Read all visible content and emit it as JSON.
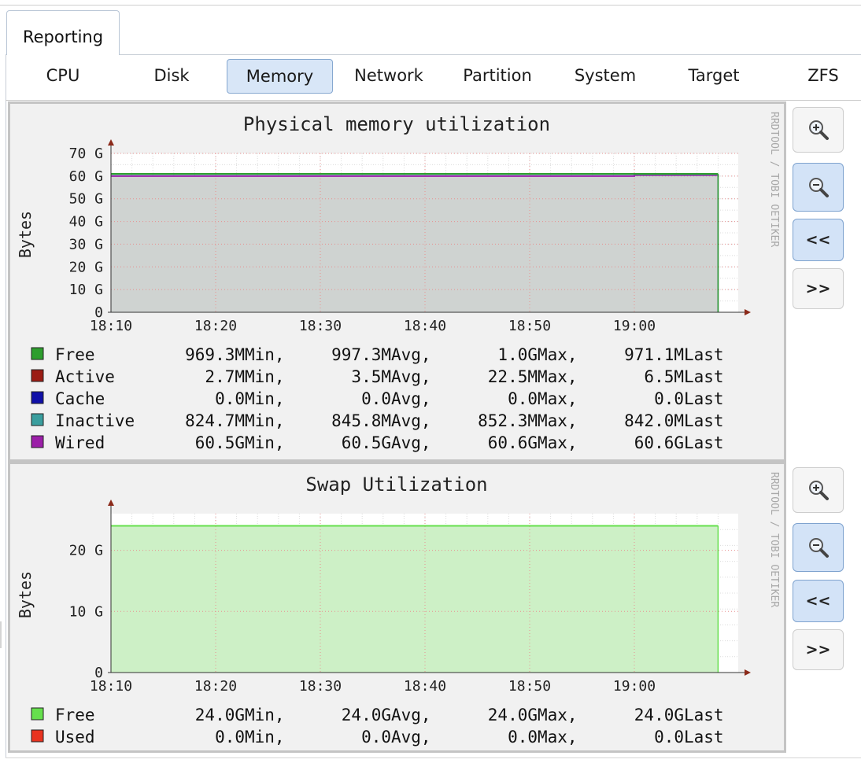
{
  "app_tab": {
    "label": "Reporting"
  },
  "subtabs": [
    {
      "label": "CPU"
    },
    {
      "label": "Disk"
    },
    {
      "label": "Memory"
    },
    {
      "label": "Network"
    },
    {
      "label": "Partition"
    },
    {
      "label": "System"
    },
    {
      "label": "Target"
    },
    {
      "label": "ZFS"
    }
  ],
  "active_subtab": "Memory",
  "graph_controls": {
    "zoom_in_icon": "magnifier-plus-icon",
    "zoom_out_icon": "magnifier-minus-icon",
    "back_label": "<<",
    "forward_label": ">>"
  },
  "watermark": "RRDTOOL / TOBI OETIKER",
  "colors": {
    "free_green": "#2e9e2e",
    "active_red": "#9b1c14",
    "cache_blue": "#1010a8",
    "inactive_teal": "#3a9e9e",
    "wired_purple": "#9b1fa8",
    "swap_free": "#66e04d",
    "swap_used": "#e8331f",
    "active_tab_bg": "#d8e6f7"
  },
  "graphs": {
    "memory": {
      "title": "Physical memory utilization",
      "ylabel": "Bytes",
      "chart_data": {
        "type": "area",
        "title": "Physical memory utilization",
        "xlabel": "",
        "ylabel": "Bytes",
        "x_ticks": [
          "18:10",
          "18:20",
          "18:30",
          "18:40",
          "18:50",
          "19:00"
        ],
        "y_ticks": [
          "0",
          "10 G",
          "20 G",
          "30 G",
          "40 G",
          "50 G",
          "60 G",
          "70 G"
        ],
        "ylim": [
          0,
          70
        ],
        "stacked": true,
        "grid": true,
        "series": [
          {
            "name": "Wired",
            "color": "#9b1fa8",
            "points": [
              [
                "18:10",
                60.0
              ],
              [
                "19:00",
                60.0
              ],
              [
                "19:00",
                60.4
              ],
              [
                "19:08",
                60.4
              ]
            ]
          },
          {
            "name": "Inactive",
            "color": "#3a9e9e",
            "points": [
              [
                "18:10",
                0.8
              ],
              [
                "19:08",
                0.8
              ]
            ]
          },
          {
            "name": "Cache",
            "color": "#1010a8",
            "points": [
              [
                "18:10",
                0.0
              ],
              [
                "19:08",
                0.0
              ]
            ]
          },
          {
            "name": "Active",
            "color": "#9b1c14",
            "points": [
              [
                "18:10",
                0.0
              ],
              [
                "19:08",
                0.0
              ]
            ]
          },
          {
            "name": "Free",
            "color": "#2e9e2e",
            "points": [
              [
                "18:10",
                1.0
              ],
              [
                "19:08",
                1.0
              ]
            ]
          }
        ]
      },
      "legend_header": [
        "Min,",
        "Avg,",
        "Max,",
        "Last"
      ],
      "legend": [
        {
          "name": "Free",
          "color": "#2e9e2e",
          "min": "969.3M",
          "avg": "997.3M",
          "max": "1.0G",
          "last": "971.1M"
        },
        {
          "name": "Active",
          "color": "#9b1c14",
          "min": "2.7M",
          "avg": "3.5M",
          "max": "22.5M",
          "last": "6.5M"
        },
        {
          "name": "Cache",
          "color": "#1010a8",
          "min": "0.0",
          "avg": "0.0",
          "max": "0.0",
          "last": "0.0"
        },
        {
          "name": "Inactive",
          "color": "#3a9e9e",
          "min": "824.7M",
          "avg": "845.8M",
          "max": "852.3M",
          "last": "842.0M"
        },
        {
          "name": "Wired",
          "color": "#9b1fa8",
          "min": "60.5G",
          "avg": "60.5G",
          "max": "60.6G",
          "last": "60.6G"
        }
      ]
    },
    "swap": {
      "title": "Swap Utilization",
      "ylabel": "Bytes",
      "chart_data": {
        "type": "area",
        "title": "Swap Utilization",
        "xlabel": "",
        "ylabel": "Bytes",
        "x_ticks": [
          "18:10",
          "18:20",
          "18:30",
          "18:40",
          "18:50",
          "19:00"
        ],
        "y_ticks": [
          "0",
          "10 G",
          "20 G"
        ],
        "ylim": [
          0,
          26
        ],
        "stacked": true,
        "grid": true,
        "series": [
          {
            "name": "Free",
            "color": "#66e04d",
            "points": [
              [
                "18:10",
                24.0
              ],
              [
                "19:08",
                24.0
              ]
            ]
          },
          {
            "name": "Used",
            "color": "#e8331f",
            "points": [
              [
                "18:10",
                0.0
              ],
              [
                "19:08",
                0.0
              ]
            ]
          }
        ]
      },
      "legend": [
        {
          "name": "Free",
          "color": "#66e04d",
          "min": "24.0G",
          "avg": "24.0G",
          "max": "24.0G",
          "last": "24.0G"
        },
        {
          "name": "Used",
          "color": "#e8331f",
          "min": "0.0",
          "avg": "0.0",
          "max": "0.0",
          "last": "0.0"
        }
      ]
    }
  }
}
